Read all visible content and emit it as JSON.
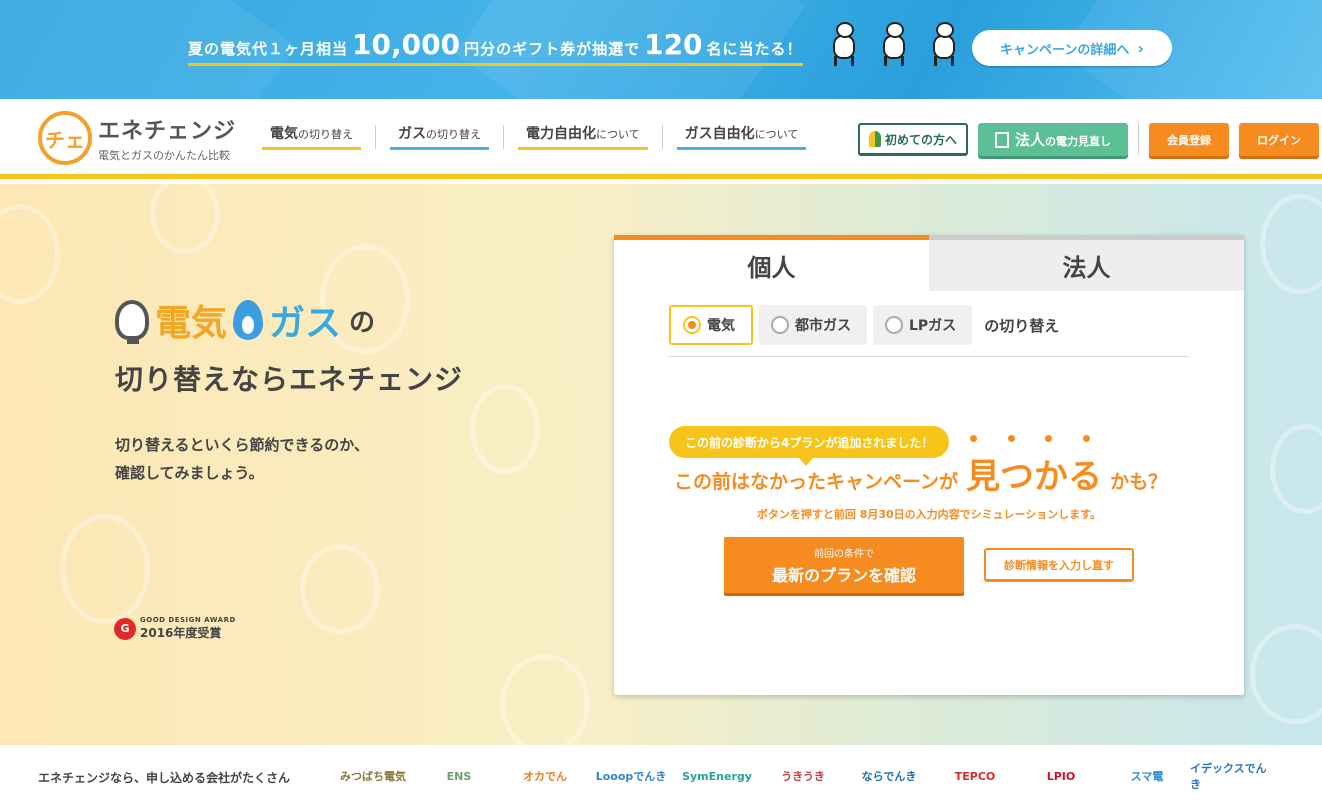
{
  "banner": {
    "text_a": "夏の電気代１ヶ月相当",
    "num_a": "10,000",
    "text_b": "円分のギフト券が抽選で",
    "num_b": "120",
    "text_c": "名に当たる！",
    "cta_label": "キャンペーンの詳細へ"
  },
  "header": {
    "logo_mark": "チェ",
    "logo_name": "エネチェンジ",
    "logo_sub": "電気とガスのかんたん比較",
    "nav": [
      {
        "main": "電気",
        "sub": "の切り替え"
      },
      {
        "main": "ガス",
        "sub": "の切り替え"
      },
      {
        "main": "電力自由化",
        "sub": "について"
      },
      {
        "main": "ガス自由化",
        "sub": "について"
      }
    ],
    "first_time_label": "初めての方へ",
    "corporate_main": "法人",
    "corporate_sub": "の電力見直し",
    "signup_label": "会員登録",
    "login_label": "ログイン"
  },
  "hero": {
    "word_denki": "電気",
    "word_gas": "ガス",
    "word_no": "の",
    "line2": "切り替えならエネチェンジ",
    "desc1": "切り替えるといくら節約できるのか、",
    "desc2": "確認してみましょう。",
    "award_label": "GOOD DESIGN AWARD",
    "award_year": "2016年度受賞",
    "award_mark": "G"
  },
  "card": {
    "tab_personal": "個人",
    "tab_corporate": "法人",
    "options": [
      "電気",
      "都市ガス",
      "LPガス"
    ],
    "selected_option": "電気",
    "switch_label": "の切り替え",
    "bubble": "この前の診断から4プランが追加されました！",
    "headline_a": "この前はなかったキャンペーンが",
    "headline_b": "見つかる",
    "headline_c": "かも？",
    "note": "ボタンを押すと前回 8月30日の入力内容でシミュレーションします。",
    "confirm_small": "前回の条件で",
    "confirm_large": "最新のプランを確認",
    "reenter_label": "診断情報を入力し直す"
  },
  "footer": {
    "text": "エネチェンジなら、申し込める会社がたくさん",
    "partners": [
      {
        "name": "みつばち電気",
        "color": "#8a7a3a"
      },
      {
        "name": "ENS",
        "color": "#6aa06a"
      },
      {
        "name": "オカでん",
        "color": "#e3801e"
      },
      {
        "name": "Looopでんき",
        "color": "#2f86d1"
      },
      {
        "name": "SymEnergy",
        "color": "#2aa39a"
      },
      {
        "name": "うきうき",
        "color": "#c33b3b"
      },
      {
        "name": "ならでんき",
        "color": "#1f6fb5"
      },
      {
        "name": "TEPCO",
        "color": "#d42a2a"
      },
      {
        "name": "LPIO",
        "color": "#c0142b"
      },
      {
        "name": "スマ電",
        "color": "#2a8fd6"
      },
      {
        "name": "イデックスでんき",
        "color": "#2b72c8"
      }
    ]
  },
  "colors": {
    "accent_orange": "#f68b1f",
    "accent_yellow": "#f7c519",
    "accent_blue": "#3aa7df",
    "corporate_green": "#5cbf95"
  }
}
